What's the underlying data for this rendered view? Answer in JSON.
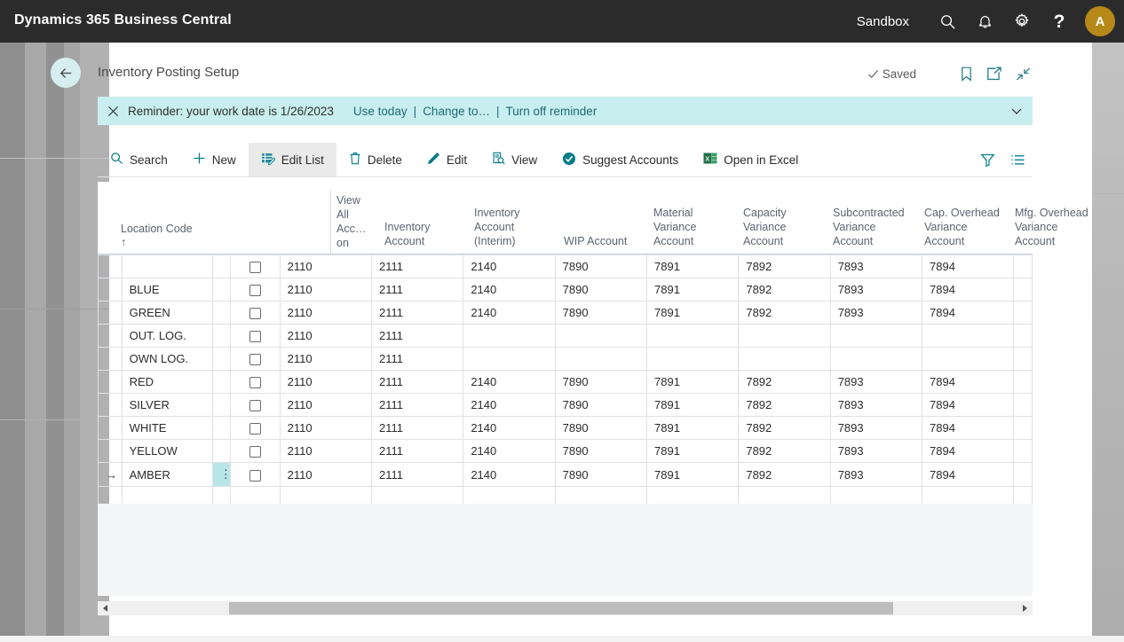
{
  "app": {
    "brand": "Dynamics 365 Business Central",
    "environment": "Sandbox",
    "icons": {
      "search": "search-icon",
      "notification": "bell-icon",
      "settings": "gear-icon",
      "help": "?",
      "avatar_initial": "A"
    }
  },
  "page": {
    "title": "Inventory Posting Setup",
    "back_label": "back-arrow",
    "save_status": "Saved",
    "actions": {
      "bookmark": "bookmark-icon",
      "open_new_window": "open-in-new-window-icon",
      "minimize": "collapse-icon"
    }
  },
  "notification": {
    "message": "Reminder: your work date is 1/26/2023",
    "links": [
      "Use today",
      "Change to…",
      "Turn off reminder"
    ],
    "separator": "|",
    "close": "✕",
    "background": "#c9eef0",
    "link_color": "#1d6b74"
  },
  "toolbar": {
    "buttons": [
      {
        "label": "Search",
        "icon": "search-icon",
        "active": false
      },
      {
        "label": "New",
        "icon": "plus-icon",
        "active": false
      },
      {
        "label": "Edit List",
        "icon": "edit-list-icon",
        "active": true
      },
      {
        "label": "Delete",
        "icon": "trash-icon",
        "active": false
      },
      {
        "label": "Edit",
        "icon": "pencil-icon",
        "active": false
      },
      {
        "label": "View",
        "icon": "page-view-icon",
        "active": false
      },
      {
        "label": "Suggest Accounts",
        "icon": "check-circle-icon",
        "active": false
      },
      {
        "label": "Open in Excel",
        "icon": "excel-icon",
        "active": false
      }
    ],
    "right_icons": [
      {
        "name": "filter-icon"
      },
      {
        "name": "list-options-icon"
      }
    ],
    "accent_color": "#007b8a"
  },
  "grid": {
    "columns": [
      {
        "key": "indicator",
        "label": ""
      },
      {
        "key": "location_code",
        "label": "Location Code",
        "sorted": true,
        "sort_arrow": "↑"
      },
      {
        "key": "row_menu",
        "label": ""
      },
      {
        "key": "view_all_accounts_on",
        "label": "View All Acc… on"
      },
      {
        "key": "inventory_account",
        "label": "Inventory Account"
      },
      {
        "key": "inventory_account_interim",
        "label": "Inventory Account (Interim)"
      },
      {
        "key": "wip_account",
        "label": "WIP Account"
      },
      {
        "key": "material_variance_account",
        "label": "Material Variance Account"
      },
      {
        "key": "capacity_variance_account",
        "label": "Capacity Variance Account"
      },
      {
        "key": "subcontracted_variance_account",
        "label": "Subcontracted Variance Account"
      },
      {
        "key": "cap_overhead_variance_account",
        "label": "Cap. Overhead Variance Account"
      },
      {
        "key": "mfg_overhead_variance_account",
        "label": "Mfg. Overhead Variance Account"
      }
    ],
    "column_header_lines": {
      "location_code": [
        "Location Code"
      ],
      "view_all_accounts_on": [
        "View",
        "All",
        "Acc…",
        "on"
      ],
      "inventory_account": [
        "Inventory",
        "Account"
      ],
      "inventory_account_interim": [
        "Inventory",
        "Account",
        "(Interim)"
      ],
      "wip_account": [
        "WIP Account"
      ],
      "material_variance_account": [
        "Material",
        "Variance",
        "Account"
      ],
      "capacity_variance_account": [
        "Capacity",
        "Variance",
        "Account"
      ],
      "subcontracted_variance_account": [
        "Subcontracted",
        "Variance",
        "Account"
      ],
      "cap_overhead_variance_account": [
        "Cap. Overhead",
        "Variance",
        "Account"
      ],
      "mfg_overhead_variance_account": [
        "Mfg. Overhead",
        "Variance",
        "Account"
      ]
    },
    "rows": [
      {
        "indicator": "",
        "location_code": "",
        "selected": false,
        "checked": false,
        "inventory_account": "2110",
        "inventory_account_interim": "2111",
        "wip_account": "2140",
        "material_variance_account": "7890",
        "capacity_variance_account": "7891",
        "subcontracted_variance_account": "7892",
        "cap_overhead_variance_account": "7893",
        "mfg_overhead_variance_account": "7894"
      },
      {
        "indicator": "",
        "location_code": "BLUE",
        "selected": false,
        "checked": false,
        "inventory_account": "2110",
        "inventory_account_interim": "2111",
        "wip_account": "2140",
        "material_variance_account": "7890",
        "capacity_variance_account": "7891",
        "subcontracted_variance_account": "7892",
        "cap_overhead_variance_account": "7893",
        "mfg_overhead_variance_account": "7894"
      },
      {
        "indicator": "",
        "location_code": "GREEN",
        "selected": false,
        "checked": false,
        "inventory_account": "2110",
        "inventory_account_interim": "2111",
        "wip_account": "2140",
        "material_variance_account": "7890",
        "capacity_variance_account": "7891",
        "subcontracted_variance_account": "7892",
        "cap_overhead_variance_account": "7893",
        "mfg_overhead_variance_account": "7894"
      },
      {
        "indicator": "",
        "location_code": "OUT. LOG.",
        "selected": false,
        "checked": false,
        "inventory_account": "2110",
        "inventory_account_interim": "2111",
        "wip_account": "",
        "material_variance_account": "",
        "capacity_variance_account": "",
        "subcontracted_variance_account": "",
        "cap_overhead_variance_account": "",
        "mfg_overhead_variance_account": ""
      },
      {
        "indicator": "",
        "location_code": "OWN LOG.",
        "selected": false,
        "checked": false,
        "inventory_account": "2110",
        "inventory_account_interim": "2111",
        "wip_account": "",
        "material_variance_account": "",
        "capacity_variance_account": "",
        "subcontracted_variance_account": "",
        "cap_overhead_variance_account": "",
        "mfg_overhead_variance_account": ""
      },
      {
        "indicator": "",
        "location_code": "RED",
        "selected": false,
        "checked": false,
        "inventory_account": "2110",
        "inventory_account_interim": "2111",
        "wip_account": "2140",
        "material_variance_account": "7890",
        "capacity_variance_account": "7891",
        "subcontracted_variance_account": "7892",
        "cap_overhead_variance_account": "7893",
        "mfg_overhead_variance_account": "7894"
      },
      {
        "indicator": "",
        "location_code": "SILVER",
        "selected": false,
        "checked": false,
        "inventory_account": "2110",
        "inventory_account_interim": "2111",
        "wip_account": "2140",
        "material_variance_account": "7890",
        "capacity_variance_account": "7891",
        "subcontracted_variance_account": "7892",
        "cap_overhead_variance_account": "7893",
        "mfg_overhead_variance_account": "7894"
      },
      {
        "indicator": "",
        "location_code": "WHITE",
        "selected": false,
        "checked": false,
        "inventory_account": "2110",
        "inventory_account_interim": "2111",
        "wip_account": "2140",
        "material_variance_account": "7890",
        "capacity_variance_account": "7891",
        "subcontracted_variance_account": "7892",
        "cap_overhead_variance_account": "7893",
        "mfg_overhead_variance_account": "7894"
      },
      {
        "indicator": "",
        "location_code": "YELLOW",
        "selected": false,
        "checked": false,
        "inventory_account": "2110",
        "inventory_account_interim": "2111",
        "wip_account": "2140",
        "material_variance_account": "7890",
        "capacity_variance_account": "7891",
        "subcontracted_variance_account": "7892",
        "cap_overhead_variance_account": "7893",
        "mfg_overhead_variance_account": "7894"
      },
      {
        "indicator": "→",
        "location_code": "AMBER",
        "selected": true,
        "checked": false,
        "row_menu": "⋮",
        "inventory_account": "2110",
        "inventory_account_interim": "2111",
        "wip_account": "2140",
        "material_variance_account": "7890",
        "capacity_variance_account": "7891",
        "subcontracted_variance_account": "7892",
        "cap_overhead_variance_account": "7893",
        "mfg_overhead_variance_account": "7894"
      },
      {
        "indicator": "",
        "location_code": "",
        "selected": false,
        "checked": null,
        "inventory_account": "",
        "inventory_account_interim": "",
        "wip_account": "",
        "material_variance_account": "",
        "capacity_variance_account": "",
        "subcontracted_variance_account": "",
        "cap_overhead_variance_account": "",
        "mfg_overhead_variance_account": ""
      }
    ],
    "selected_row_highlight": "#b8e6e8"
  },
  "scrollbar": {
    "left_arrow": "◀",
    "right_arrow": "▶",
    "thumb_position_pct": 13,
    "thumb_width_pct": 72
  }
}
